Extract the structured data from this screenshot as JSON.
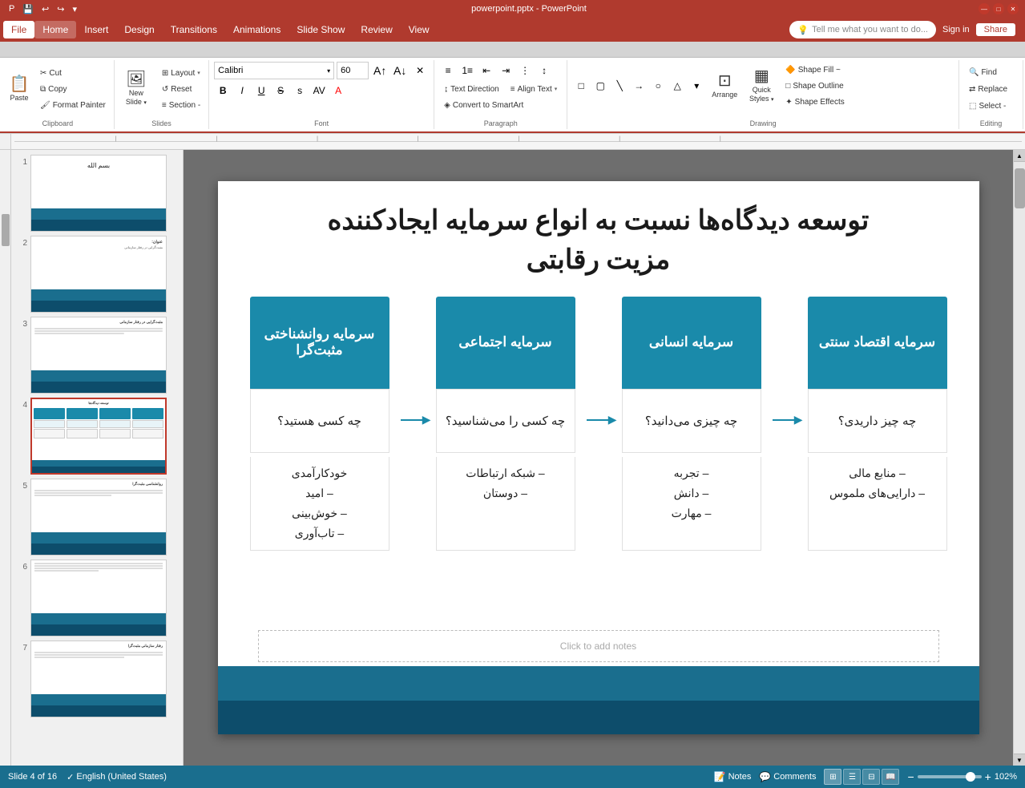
{
  "titlebar": {
    "title": "powerpoint.pptx - PowerPoint",
    "quick_access": [
      "save",
      "undo",
      "redo"
    ],
    "win_controls": [
      "minimize",
      "maximize",
      "close"
    ]
  },
  "menubar": {
    "items": [
      "File",
      "Home",
      "Insert",
      "Design",
      "Transitions",
      "Animations",
      "Slide Show",
      "Review",
      "View"
    ],
    "active": "Home",
    "search_placeholder": "Tell me what you want to do...",
    "sign_in": "Sign in",
    "share": "Share"
  },
  "ribbon": {
    "groups": [
      {
        "name": "Clipboard",
        "buttons": [
          "Paste",
          "Cut",
          "Copy",
          "Format Painter"
        ]
      },
      {
        "name": "Slides",
        "buttons": [
          "New Slide",
          "Layout",
          "Reset",
          "Section"
        ]
      },
      {
        "name": "Font",
        "font_name": "Calibri",
        "font_size": "60",
        "buttons": [
          "Bold",
          "Italic",
          "Underline",
          "Strikethrough",
          "Shadow",
          "Character Spacing",
          "Font Color"
        ]
      },
      {
        "name": "Paragraph",
        "buttons": [
          "Bullets",
          "Numbering",
          "Indent",
          "Text Direction",
          "Align Text",
          "Convert to SmartArt"
        ]
      },
      {
        "name": "Drawing",
        "buttons": [
          "Arrange",
          "Quick Styles",
          "Shape Fill",
          "Shape Outline",
          "Shape Effects"
        ]
      },
      {
        "name": "Editing",
        "buttons": [
          "Find",
          "Replace",
          "Select"
        ]
      }
    ],
    "section_label": "Section -",
    "text_direction_label": "Text Direction",
    "align_text_label": "Align Text",
    "convert_smartart_label": "Convert to SmartArt",
    "quick_styles_label": "Quick Styles -",
    "shape_fill_label": "Shape Fill ~",
    "shape_outline_label": "Shape Outline",
    "shape_effects_label": "Shape Effects",
    "find_label": "Find",
    "replace_label": "Replace",
    "select_label": "Select -"
  },
  "slide": {
    "title": "توسعه دیدگاه‌ها نسبت به انواع سرمایه ایجادکننده\nمزیت رقابتی",
    "columns": [
      {
        "header": "سرمایه اقتصاد سنتی",
        "question": "چه چیز داریدی؟",
        "items": "– منابع مالی\n– دارایی‌های ملموس"
      },
      {
        "header": "سرمایه انسانی",
        "question": "چه چیزی می‌دانید؟",
        "items": "– تجربه\n– دانش\n– مهارت"
      },
      {
        "header": "سرمایه اجتماعی",
        "question": "چه کسی را می‌شناسید؟",
        "items": "– شبکه ارتباطات\n– دوستان"
      },
      {
        "header": "سرمایه روانشناختی مثبت‌گرا",
        "question": "چه کسی هستید؟",
        "items": "خودکارآمدی\n– امید\n– خوش‌بینی\n– تاب‌آوری"
      }
    ],
    "note_placeholder": "Click to add notes"
  },
  "slide_panel": {
    "slides": [
      {
        "num": 1,
        "type": "arabic"
      },
      {
        "num": 2,
        "type": "title",
        "title": "عنوان:",
        "subtitle": "مثبت‌گرایی در رفتار سازمانی"
      },
      {
        "num": 3,
        "type": "text",
        "title": "مثبت‌گرایی در رفتار سازمانی"
      },
      {
        "num": 4,
        "type": "current",
        "active": true
      },
      {
        "num": 5,
        "type": "text2",
        "title": "روانشناسی مثبت‌گرا"
      },
      {
        "num": 6,
        "type": "text3"
      },
      {
        "num": 7,
        "type": "text4",
        "title": "رفتار سازمانی مثبت‌گرا"
      }
    ]
  },
  "statusbar": {
    "slide_info": "Slide 4 of 16",
    "language": "English (United States)",
    "notes_label": "Notes",
    "comments_label": "Comments",
    "view_buttons": [
      "normal",
      "outline",
      "slide-sorter",
      "reading"
    ],
    "zoom": "102%"
  }
}
